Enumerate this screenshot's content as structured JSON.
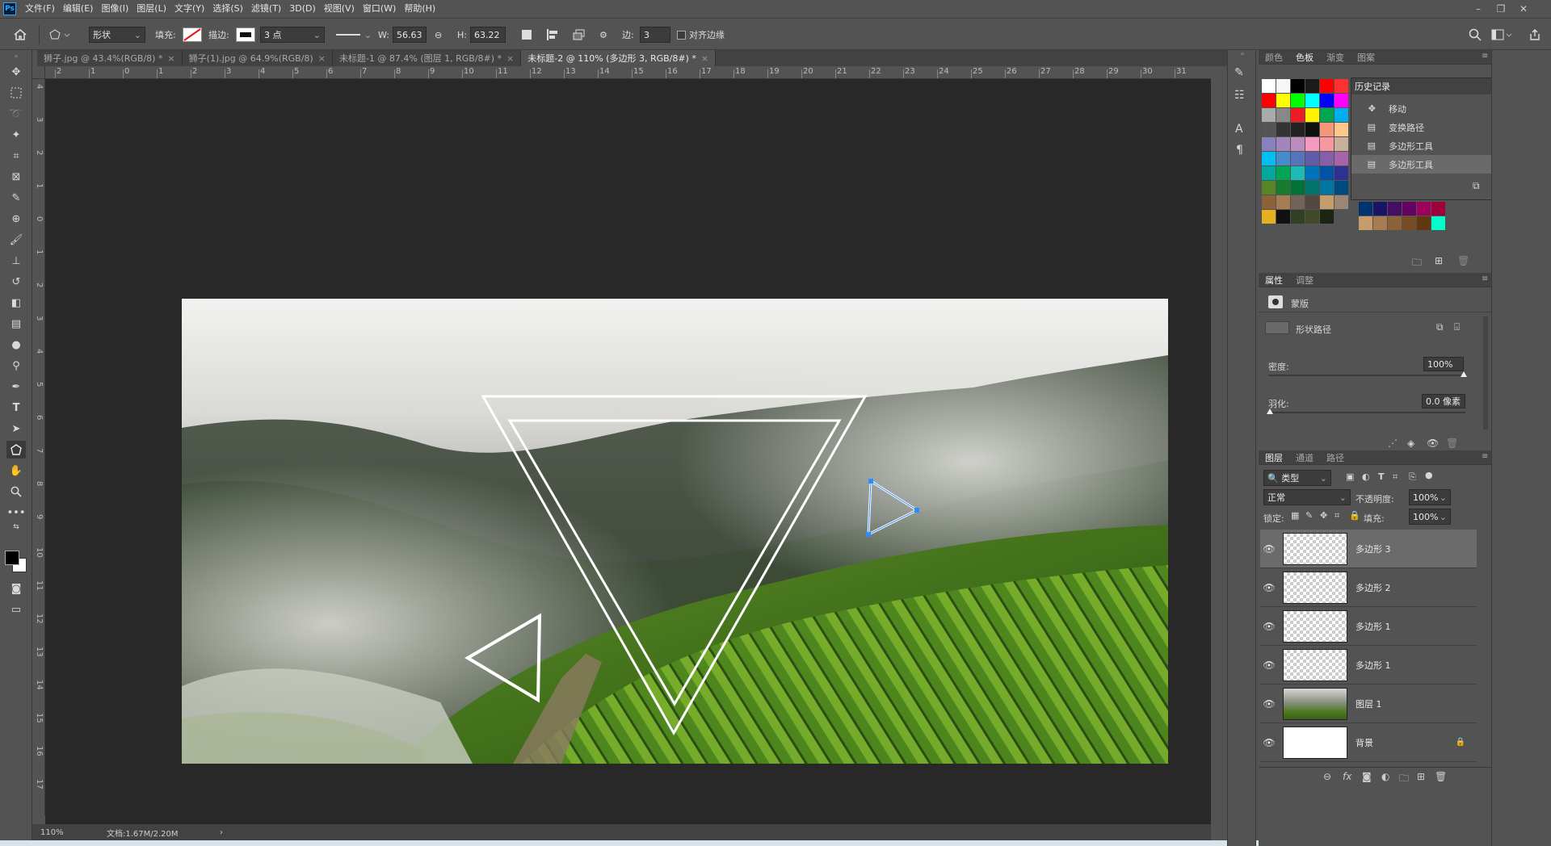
{
  "app": {
    "logo": "Ps"
  },
  "menu": [
    "文件(F)",
    "编辑(E)",
    "图像(I)",
    "图层(L)",
    "文字(Y)",
    "选择(S)",
    "滤镜(T)",
    "3D(D)",
    "视图(V)",
    "窗口(W)",
    "帮助(H)"
  ],
  "options": {
    "mode": "形状",
    "fill_label": "填充:",
    "stroke_label": "描边:",
    "stroke_size": "3 点",
    "w_label": "W:",
    "w_value": "56.63",
    "h_label": "H:",
    "h_value": "63.22",
    "sides_label": "边:",
    "sides_value": "3",
    "align_edges": "对齐边缘"
  },
  "tabs": [
    {
      "label": "狮子.jpg @ 43.4%(RGB/8) *",
      "active": false
    },
    {
      "label": "狮子(1).jpg @ 64.9%(RGB/8)",
      "active": false
    },
    {
      "label": "未标题-1 @ 87.4% (图层 1, RGB/8#) *",
      "active": false
    },
    {
      "label": "未标题-2 @ 110% (多边形 3, RGB/8#) *",
      "active": true
    }
  ],
  "ruler_h": [
    "2",
    "1",
    "0",
    "1",
    "2",
    "3",
    "4",
    "5",
    "6",
    "7",
    "8",
    "9",
    "10",
    "11",
    "12",
    "13",
    "14",
    "15",
    "16",
    "17",
    "18",
    "19",
    "20",
    "21",
    "22",
    "23",
    "24",
    "25",
    "26",
    "27",
    "28",
    "29",
    "30",
    "31"
  ],
  "ruler_v": [
    "4",
    "3",
    "2",
    "1",
    "0",
    "1",
    "2",
    "3",
    "4",
    "5",
    "6",
    "7",
    "8",
    "9",
    "10",
    "11",
    "12",
    "13",
    "14",
    "15",
    "16",
    "17"
  ],
  "status": {
    "zoom": "110%",
    "doc": "文档:1.67M/2.20M",
    "arrow": "›"
  },
  "swatch_tabs": [
    "颜色",
    "色板",
    "渐变",
    "图案"
  ],
  "swatches": [
    [
      "#ffffff",
      "#f7f7f7",
      "#000000",
      "#1a1a1a",
      "#ff0000",
      "#ff3030"
    ],
    [
      "#ff0000",
      "#ffff00",
      "#00ff00",
      "#00ffff",
      "#0000ff",
      "#ff00ff"
    ],
    [
      "#aaaaaa",
      "#888888",
      "#ee1c24",
      "#fff200",
      "#00a651",
      "#00aeef"
    ],
    [
      "#555555",
      "#333333",
      "#222222",
      "#111111",
      "#f7977a",
      "#fdc68a"
    ],
    [
      "#8781bd",
      "#a186be",
      "#bd8cbf",
      "#f49ac1",
      "#f6989d",
      "#c7b299"
    ],
    [
      "#00bff3",
      "#448ccb",
      "#5674b9",
      "#605ca8",
      "#855fa8",
      "#a864a8"
    ],
    [
      "#00a99d",
      "#00a651",
      "#1cbbb4",
      "#0072bc",
      "#0054a6",
      "#2e3192"
    ],
    [
      "#598527",
      "#197b30",
      "#007236",
      "#00746b",
      "#0076a3",
      "#004a80"
    ],
    [
      "#8c6239",
      "#a67c52",
      "#736357",
      "#534741",
      "#c69c6d",
      "#998675"
    ],
    [
      "#e5b123",
      "#111111",
      "#333f23",
      "#404a2a",
      "#1c2413",
      ""
    ]
  ],
  "swatches_extra": [
    [
      "#003471",
      "#1b1464",
      "#440e62",
      "#630460",
      "#9e005d",
      "#9e0039"
    ],
    [
      "#c69c6d",
      "#a67c52",
      "#8c6239",
      "#754c24",
      "#603913",
      "#00ffcc"
    ]
  ],
  "history": {
    "title": "历史记录",
    "items": [
      "移动",
      "变换路径",
      "多边形工具",
      "多边形工具"
    ]
  },
  "properties": {
    "tabs": [
      "属性",
      "调整"
    ],
    "mask_label": "蒙版",
    "shape_path": "形状路径",
    "density_label": "密度:",
    "density_value": "100%",
    "feather_label": "羽化:",
    "feather_value": "0.0 像素"
  },
  "layers": {
    "tabs": [
      "图层",
      "通道",
      "路径"
    ],
    "filter": "类型",
    "blend": "正常",
    "opacity_label": "不透明度:",
    "opacity_value": "100%",
    "lock_label": "锁定:",
    "fill_label": "填充:",
    "fill_value": "100%",
    "items": [
      {
        "name": "多边形 3",
        "type": "shape",
        "selected": true
      },
      {
        "name": "多边形 2",
        "type": "shape",
        "selected": false
      },
      {
        "name": "多边形 1",
        "type": "shape",
        "selected": false
      },
      {
        "name": "多边形 1",
        "type": "shape",
        "selected": false
      },
      {
        "name": "图层 1",
        "type": "photo",
        "selected": false
      },
      {
        "name": "背景",
        "type": "white",
        "selected": false
      }
    ]
  },
  "colors": {
    "fg": "#000000",
    "bg": "#ffffff",
    "workspace": "#282828",
    "panel": "#535353"
  }
}
